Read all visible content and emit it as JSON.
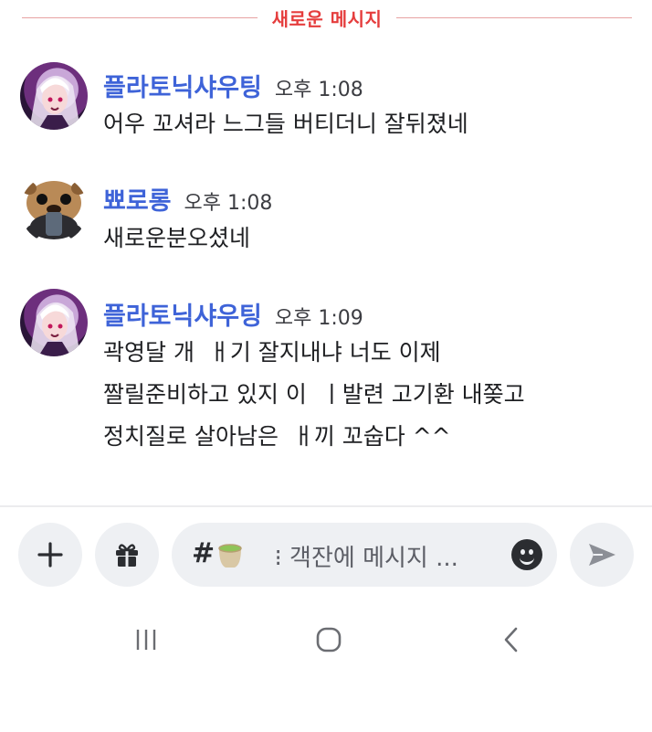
{
  "divider": {
    "label": "새로운 메시지"
  },
  "messages": [
    {
      "author": "플라토닉샤우팅",
      "time": "오후 1:08",
      "lines": [
        "어우 꼬셔라 느그들 버티더니 잘뒤졌네"
      ]
    },
    {
      "author": "뾰로롱",
      "time": "오후 1:08",
      "lines": [
        "새로운분오셨네"
      ]
    },
    {
      "author": "플라토닉샤우팅",
      "time": "오후 1:09",
      "lines": [
        "곽영달 개  ㅐ기 잘지내냐 너도 이제",
        "짤릴준비하고 있지 이  ㅣ발련 고기환 내쫒고",
        "정치질로 살아남은  ㅐ끼 꼬숩다 ^^"
      ]
    }
  ],
  "composer": {
    "hash": "#",
    "placeholder": "  ⁝ 객잔에 메시지 ..."
  },
  "colors": {
    "author": "#3e63d8",
    "divider": "#e53d3d"
  },
  "icons": [
    "plus-icon",
    "gift-icon",
    "tea-icon",
    "emoji-icon",
    "send-icon",
    "recent-apps-icon",
    "home-icon",
    "back-icon"
  ]
}
